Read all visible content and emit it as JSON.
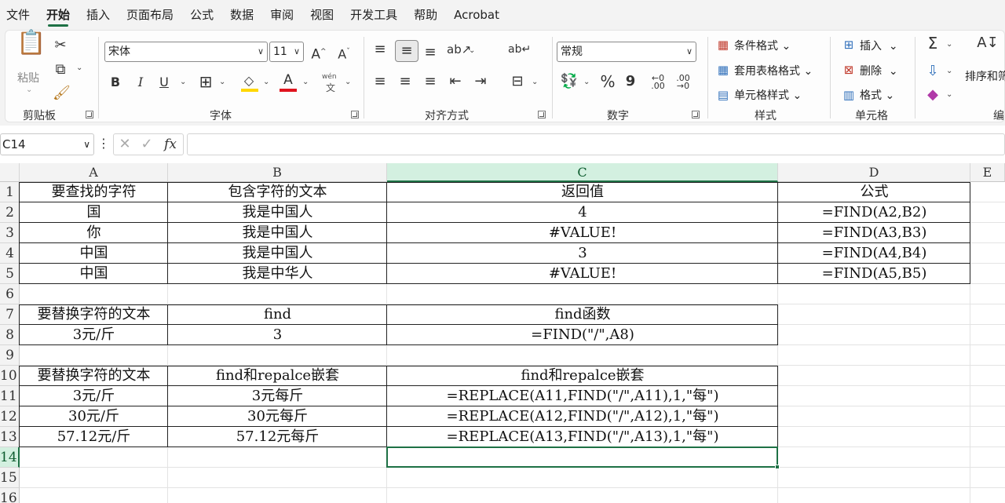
{
  "menu": {
    "tabs": [
      "文件",
      "开始",
      "插入",
      "页面布局",
      "公式",
      "数据",
      "审阅",
      "视图",
      "开发工具",
      "帮助",
      "Acrobat"
    ],
    "active": "开始"
  },
  "ribbon": {
    "clipboard": {
      "paste": "粘贴",
      "label": "剪贴板"
    },
    "font": {
      "name": "宋体",
      "size": "11",
      "label": "字体",
      "bold": "B",
      "italic": "I",
      "underline": "U",
      "grow": "A^",
      "shrink": "Aˇ",
      "phonetic_top": "wén",
      "phonetic_bottom": "文",
      "font_color": "A"
    },
    "alignment": {
      "label": "对齐方式"
    },
    "number": {
      "format": "常规",
      "label": "数字",
      "percent": "%",
      "comma": "9",
      "inc_decimal": ".00",
      "dec_decimal": ".00"
    },
    "styles": {
      "conditional": "条件格式",
      "table": "套用表格格式",
      "cell": "单元格样式",
      "label": "样式"
    },
    "cells": {
      "insert": "插入",
      "delete": "删除",
      "format": "格式",
      "label": "单元格"
    },
    "editing": {
      "sort": "排序和筛",
      "label": "编"
    }
  },
  "formula_bar": {
    "name_box": "C14",
    "fx": "fx",
    "formula": ""
  },
  "sheet": {
    "columns": [
      "A",
      "B",
      "C",
      "D",
      "E"
    ],
    "rows": [
      "1",
      "2",
      "3",
      "4",
      "5",
      "6",
      "7",
      "8",
      "9",
      "10",
      "11",
      "12",
      "13",
      "14",
      "15",
      "16"
    ],
    "selected_cell": "C14",
    "cells": {
      "A1": "要查找的字符",
      "B1": "包含字符的文本",
      "C1": "返回值",
      "D1": "公式",
      "A2": "国",
      "B2": "我是中国人",
      "C2": "4",
      "D2": "=FIND(A2,B2)",
      "A3": "你",
      "B3": "我是中国人",
      "C3": "#VALUE!",
      "D3": "=FIND(A3,B3)",
      "A4": "中国",
      "B4": "我是中国人",
      "C4": "3",
      "D4": "=FIND(A4,B4)",
      "A5": "中国",
      "B5": "我是中华人",
      "C5": "#VALUE!",
      "D5": "=FIND(A5,B5)",
      "A7": "要替换字符的文本",
      "B7": "find",
      "C7": "find函数",
      "A8": "3元/斤",
      "B8": "3",
      "C8": "=FIND(\"/\",A8)",
      "A10": "要替换字符的文本",
      "B10": "find和repalce嵌套",
      "C10": "find和repalce嵌套",
      "A11": "3元/斤",
      "B11": "3元每斤",
      "C11": "=REPLACE(A11,FIND(\"/\",A11),1,\"每\")",
      "A12": "30元/斤",
      "B12": "30元每斤",
      "C12": "=REPLACE(A12,FIND(\"/\",A12),1,\"每\")",
      "A13": "57.12元/斤",
      "B13": "57.12元每斤",
      "C13": "=REPLACE(A13,FIND(\"/\",A13),1,\"每\")"
    }
  }
}
